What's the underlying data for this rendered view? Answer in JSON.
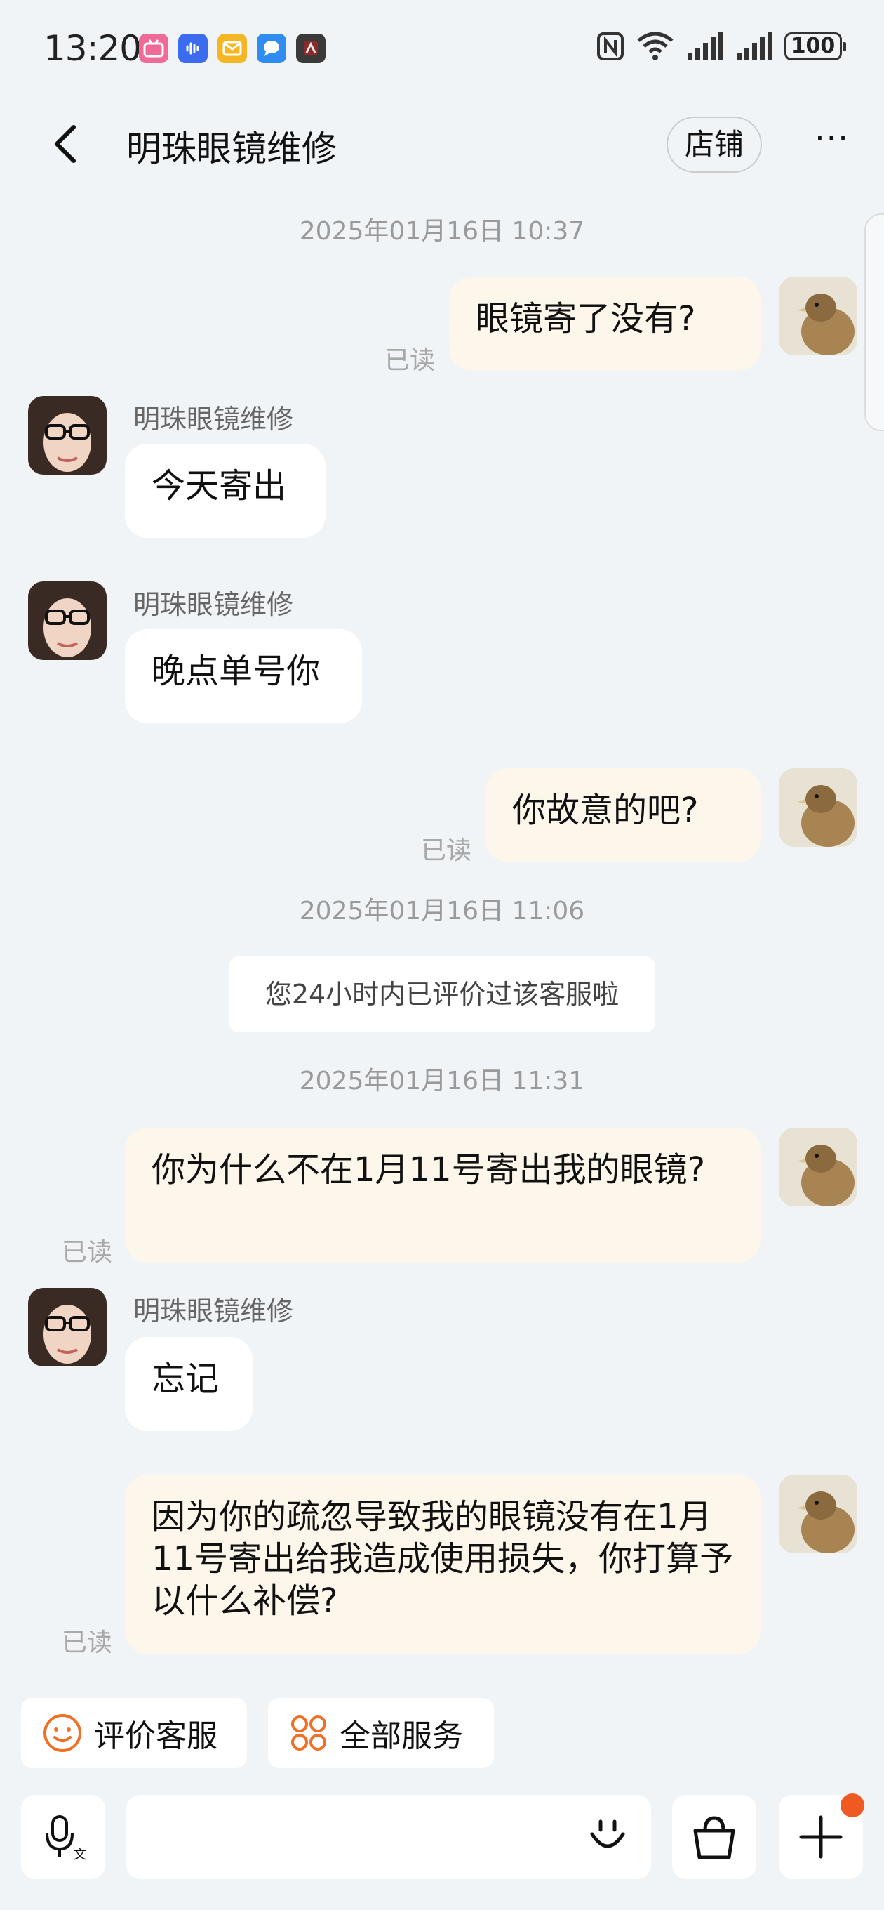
{
  "status_bar": {
    "time": "13:20",
    "battery": "100",
    "app_icons": [
      "bilibili-icon",
      "voice-recorder-icon",
      "mail-icon",
      "messages-icon",
      "game-icon"
    ],
    "system_icons": [
      "nfc-icon",
      "wifi-icon",
      "signal-icon",
      "signal-icon"
    ]
  },
  "header": {
    "title": "明珠眼镜维修",
    "shop_label": "店铺",
    "more_label": "···"
  },
  "colors": {
    "background": "#f0f4f7",
    "incoming_bubble": "#ffffff",
    "outgoing_bubble": "#fdf6eb",
    "accent": "#f05a22"
  },
  "chat": {
    "ts1": "2025年01月16日 10:37",
    "msg1": "眼镜寄了没有?",
    "read": "已读",
    "sender": "明珠眼镜维修",
    "msg2": "今天寄出",
    "msg3": "晚点单号你",
    "msg4": "你故意的吧?",
    "ts2": "2025年01月16日 11:06",
    "notice": "您24小时内已评价过该客服啦",
    "ts3": "2025年01月16日 11:31",
    "msg5": "你为什么不在1月11号寄出我的眼镜?",
    "msg6": "忘记",
    "msg7": "因为你的疏忽导致我的眼镜没有在1月11号寄出给我造成使用损失，你打算予以什么补偿?"
  },
  "quick_actions": {
    "rate": "评价客服",
    "all_services": "全部服务"
  },
  "input_bar": {
    "voice_icon": "voice-translate-icon",
    "emoji_icon": "emoji-icon",
    "bag_icon": "shopping-bag-icon",
    "plus_icon": "plus-icon"
  }
}
